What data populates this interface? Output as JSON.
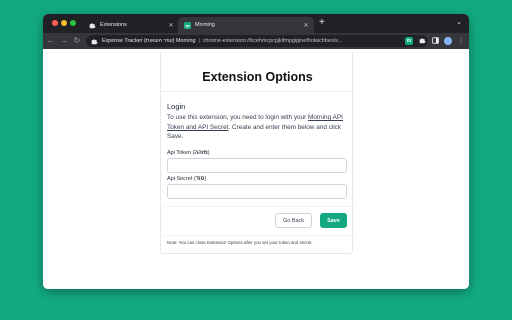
{
  "colors": {
    "desktop_bg": "#12a981",
    "accent": "#12a981",
    "tabbar": "#202124",
    "toolbar": "#35363a"
  },
  "browser": {
    "tabs": [
      {
        "label": "Extensions",
        "icon": "puzzle-icon",
        "active": false
      },
      {
        "label": "Morning",
        "icon": "morning-logo-icon",
        "active": true
      }
    ],
    "new_tab_icon": "plus-icon",
    "tab_menu_icon": "chevron-down-icon",
    "omnibox": {
      "origin": "Expense Tracker (עוזר הוצאות) Morning",
      "url": "chrome-extension://bcehmcpcpjkifmpgiginefholaichbeo/s..."
    },
    "toolbar_icons": [
      "share-icon",
      "star-icon",
      "morning-extension-icon",
      "puzzle-icon",
      "sidepanel-icon",
      "avatar",
      "more-icon"
    ]
  },
  "page": {
    "title": "Extension Options",
    "section_title": "Login",
    "description_pre": "To use this extension, you need to login with your ",
    "description_link": "Morning API Token and API Secret",
    "description_post": ". Create and enter them below and click Save.",
    "token_label": "Api Token (",
    "token_label_he": "מזהה",
    "token_label_end": ")",
    "token_value": "",
    "secret_label": "Api Secret (",
    "secret_label_he": "סוד",
    "secret_label_end": ")",
    "secret_value": "",
    "back_label": "Go Back",
    "save_label": "Save",
    "note": "Note: You can close Extension Options after you set your token and secret."
  }
}
